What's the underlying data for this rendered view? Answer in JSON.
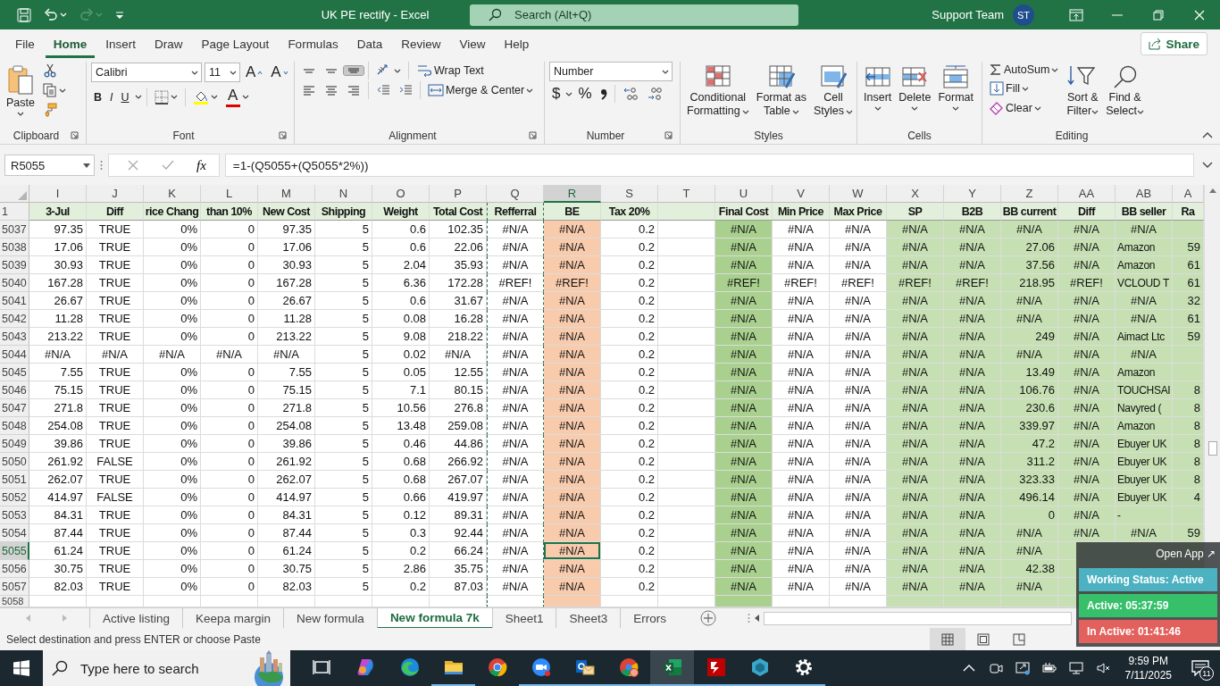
{
  "title_bar": {
    "title": "UK PE rectify  -  Excel",
    "search_placeholder": "Search (Alt+Q)",
    "user": "Support Team",
    "initials": "ST"
  },
  "menu_tabs": [
    {
      "label": "File",
      "selected": false
    },
    {
      "label": "Home",
      "selected": true
    },
    {
      "label": "Insert",
      "selected": false
    },
    {
      "label": "Draw",
      "selected": false
    },
    {
      "label": "Page Layout",
      "selected": false
    },
    {
      "label": "Formulas",
      "selected": false
    },
    {
      "label": "Data",
      "selected": false
    },
    {
      "label": "Review",
      "selected": false
    },
    {
      "label": "View",
      "selected": false
    },
    {
      "label": "Help",
      "selected": false
    }
  ],
  "share": "Share",
  "ribbon": {
    "clipboard": {
      "paste": "Paste",
      "label": "Clipboard"
    },
    "font": {
      "font": "Calibri",
      "size": "11",
      "grow": "A",
      "shrink": "A",
      "bold": "B",
      "italic": "I",
      "underline": "U",
      "font_color": "A",
      "label": "Font"
    },
    "alignment": {
      "wrap": "Wrap Text",
      "merge": "Merge & Center",
      "label": "Alignment"
    },
    "number": {
      "format": "Number",
      "currency": "$",
      "percent": "%",
      "label": "Number"
    },
    "styles": {
      "buttons": [
        [
          "Conditional",
          "Formatting"
        ],
        [
          "Format as",
          "Table"
        ],
        [
          "Cell",
          "Styles"
        ]
      ],
      "label": "Styles"
    },
    "cells": {
      "buttons": [
        "Insert",
        "Delete",
        "Format"
      ],
      "label": "Cells"
    },
    "editing": {
      "autosum": "AutoSum",
      "fill": "Fill",
      "clear": "Clear",
      "sort": [
        "Sort &",
        "Filter"
      ],
      "find": [
        "Find &",
        "Select"
      ],
      "label": "Editing"
    }
  },
  "formula_bar": {
    "name_box": "R5055",
    "function_label": "fx",
    "formula": "=1-(Q5055+(Q5055*2%))"
  },
  "columns": [
    {
      "letter": "I",
      "heading": "3-Jul",
      "kind": "number",
      "selected": false
    },
    {
      "letter": "J",
      "heading": "Diff",
      "kind": "bool",
      "selected": false
    },
    {
      "letter": "K",
      "heading": "rice Chang",
      "kind": "number",
      "selected": false
    },
    {
      "letter": "L",
      "heading": "than 10%",
      "kind": "number",
      "selected": false
    },
    {
      "letter": "M",
      "heading": "New Cost",
      "kind": "number",
      "selected": false
    },
    {
      "letter": "N",
      "heading": "Shipping",
      "kind": "number",
      "selected": false
    },
    {
      "letter": "O",
      "heading": "Weight",
      "kind": "number",
      "selected": false
    },
    {
      "letter": "P",
      "heading": "Total Cost",
      "kind": "number",
      "selected": false
    },
    {
      "letter": "Q",
      "heading": "Refferral",
      "kind": "number",
      "selected": false,
      "marquee": true
    },
    {
      "letter": "R",
      "heading": "BE",
      "kind": "number",
      "selected": true,
      "color": "#f8cbad"
    },
    {
      "letter": "S",
      "heading": "Tax 20%",
      "kind": "number",
      "selected": false
    },
    {
      "letter": "T",
      "selected": false
    },
    {
      "letter": "U",
      "heading": "Final Cost",
      "kind": "number",
      "selected": false,
      "color": "#a9d08e"
    },
    {
      "letter": "V",
      "heading": "Min Price",
      "kind": "number",
      "selected": false
    },
    {
      "letter": "W",
      "heading": "Max Price",
      "kind": "number",
      "selected": false
    },
    {
      "letter": "X",
      "heading": "SP",
      "kind": "number",
      "selected": false,
      "color": "#c6e0b4"
    },
    {
      "letter": "Y",
      "heading": "B2B",
      "kind": "number",
      "selected": false,
      "color": "#c6e0b4"
    },
    {
      "letter": "Z",
      "heading": "BB current",
      "kind": "number",
      "selected": false,
      "color": "#c6e0b4"
    },
    {
      "letter": "AA",
      "heading": "Diff",
      "kind": "number",
      "selected": false,
      "color": "#c6e0b4"
    },
    {
      "letter": "AB",
      "heading": "BB seller",
      "kind": "text",
      "selected": false,
      "color": "#c6e0b4"
    },
    {
      "letter": "A",
      "heading": "Ra",
      "kind": "number",
      "selected": false,
      "color": "#c6e0b4"
    }
  ],
  "header_row": "1",
  "rows": [
    {
      "number": "5037",
      "selected": false,
      "cells": [
        "97.35",
        "TRUE",
        "0%",
        "0",
        "97.35",
        "5",
        "0.6",
        "102.35",
        "#N/A",
        "#N/A",
        "0.2",
        null,
        "#N/A",
        "#N/A",
        "#N/A",
        "#N/A",
        "#N/A",
        "#N/A",
        "#N/A",
        "#N/A",
        null
      ]
    },
    {
      "number": "5038",
      "selected": false,
      "cells": [
        "17.06",
        "TRUE",
        "0%",
        "0",
        "17.06",
        "5",
        "0.6",
        "22.06",
        "#N/A",
        "#N/A",
        "0.2",
        null,
        "#N/A",
        "#N/A",
        "#N/A",
        "#N/A",
        "#N/A",
        "27.06",
        "#N/A",
        "Amazon",
        "59"
      ]
    },
    {
      "number": "5039",
      "selected": false,
      "cells": [
        "30.93",
        "TRUE",
        "0%",
        "0",
        "30.93",
        "5",
        "2.04",
        "35.93",
        "#N/A",
        "#N/A",
        "0.2",
        null,
        "#N/A",
        "#N/A",
        "#N/A",
        "#N/A",
        "#N/A",
        "37.56",
        "#N/A",
        "Amazon",
        "61"
      ]
    },
    {
      "number": "5040",
      "selected": false,
      "cells": [
        "167.28",
        "TRUE",
        "0%",
        "0",
        "167.28",
        "5",
        "6.36",
        "172.28",
        "#REF!",
        "#REF!",
        "0.2",
        null,
        "#REF!",
        "#REF!",
        "#REF!",
        "#REF!",
        "#REF!",
        "218.95",
        "#REF!",
        "VCLOUD T",
        "61"
      ]
    },
    {
      "number": "5041",
      "selected": false,
      "cells": [
        "26.67",
        "TRUE",
        "0%",
        "0",
        "26.67",
        "5",
        "0.6",
        "31.67",
        "#N/A",
        "#N/A",
        "0.2",
        null,
        "#N/A",
        "#N/A",
        "#N/A",
        "#N/A",
        "#N/A",
        "#N/A",
        "#N/A",
        "#N/A",
        "32"
      ]
    },
    {
      "number": "5042",
      "selected": false,
      "cells": [
        "11.28",
        "TRUE",
        "0%",
        "0",
        "11.28",
        "5",
        "0.08",
        "16.28",
        "#N/A",
        "#N/A",
        "0.2",
        null,
        "#N/A",
        "#N/A",
        "#N/A",
        "#N/A",
        "#N/A",
        "#N/A",
        "#N/A",
        "#N/A",
        "61"
      ]
    },
    {
      "number": "5043",
      "selected": false,
      "cells": [
        "213.22",
        "TRUE",
        "0%",
        "0",
        "213.22",
        "5",
        "9.08",
        "218.22",
        "#N/A",
        "#N/A",
        "0.2",
        null,
        "#N/A",
        "#N/A",
        "#N/A",
        "#N/A",
        "#N/A",
        "249",
        "#N/A",
        "Aimact Ltc",
        "59"
      ]
    },
    {
      "number": "5044",
      "selected": false,
      "cells": [
        "#N/A",
        "#N/A",
        "#N/A",
        "#N/A",
        "#N/A",
        "5",
        "0.02",
        "#N/A",
        "#N/A",
        "#N/A",
        "0.2",
        null,
        "#N/A",
        "#N/A",
        "#N/A",
        "#N/A",
        "#N/A",
        "#N/A",
        "#N/A",
        "#N/A",
        null
      ]
    },
    {
      "number": "5045",
      "selected": false,
      "cells": [
        "7.55",
        "TRUE",
        "0%",
        "0",
        "7.55",
        "5",
        "0.05",
        "12.55",
        "#N/A",
        "#N/A",
        "0.2",
        null,
        "#N/A",
        "#N/A",
        "#N/A",
        "#N/A",
        "#N/A",
        "13.49",
        "#N/A",
        "Amazon",
        null
      ]
    },
    {
      "number": "5046",
      "selected": false,
      "cells": [
        "75.15",
        "TRUE",
        "0%",
        "0",
        "75.15",
        "5",
        "7.1",
        "80.15",
        "#N/A",
        "#N/A",
        "0.2",
        null,
        "#N/A",
        "#N/A",
        "#N/A",
        "#N/A",
        "#N/A",
        "106.76",
        "#N/A",
        "TOUCHSAI",
        "8"
      ]
    },
    {
      "number": "5047",
      "selected": false,
      "cells": [
        "271.8",
        "TRUE",
        "0%",
        "0",
        "271.8",
        "5",
        "10.56",
        "276.8",
        "#N/A",
        "#N/A",
        "0.2",
        null,
        "#N/A",
        "#N/A",
        "#N/A",
        "#N/A",
        "#N/A",
        "230.6",
        "#N/A",
        "Navyred (",
        "8"
      ]
    },
    {
      "number": "5048",
      "selected": false,
      "cells": [
        "254.08",
        "TRUE",
        "0%",
        "0",
        "254.08",
        "5",
        "13.48",
        "259.08",
        "#N/A",
        "#N/A",
        "0.2",
        null,
        "#N/A",
        "#N/A",
        "#N/A",
        "#N/A",
        "#N/A",
        "339.97",
        "#N/A",
        "Amazon",
        "8"
      ]
    },
    {
      "number": "5049",
      "selected": false,
      "cells": [
        "39.86",
        "TRUE",
        "0%",
        "0",
        "39.86",
        "5",
        "0.46",
        "44.86",
        "#N/A",
        "#N/A",
        "0.2",
        null,
        "#N/A",
        "#N/A",
        "#N/A",
        "#N/A",
        "#N/A",
        "47.2",
        "#N/A",
        "Ebuyer UK",
        "8"
      ]
    },
    {
      "number": "5050",
      "selected": false,
      "cells": [
        "261.92",
        "FALSE",
        "0%",
        "0",
        "261.92",
        "5",
        "0.68",
        "266.92",
        "#N/A",
        "#N/A",
        "0.2",
        null,
        "#N/A",
        "#N/A",
        "#N/A",
        "#N/A",
        "#N/A",
        "311.2",
        "#N/A",
        "Ebuyer UK",
        "8"
      ]
    },
    {
      "number": "5051",
      "selected": false,
      "cells": [
        "262.07",
        "TRUE",
        "0%",
        "0",
        "262.07",
        "5",
        "0.68",
        "267.07",
        "#N/A",
        "#N/A",
        "0.2",
        null,
        "#N/A",
        "#N/A",
        "#N/A",
        "#N/A",
        "#N/A",
        "323.33",
        "#N/A",
        "Ebuyer UK",
        "8"
      ]
    },
    {
      "number": "5052",
      "selected": false,
      "cells": [
        "414.97",
        "FALSE",
        "0%",
        "0",
        "414.97",
        "5",
        "0.66",
        "419.97",
        "#N/A",
        "#N/A",
        "0.2",
        null,
        "#N/A",
        "#N/A",
        "#N/A",
        "#N/A",
        "#N/A",
        "496.14",
        "#N/A",
        "Ebuyer UK",
        "4"
      ]
    },
    {
      "number": "5053",
      "selected": false,
      "cells": [
        "84.31",
        "TRUE",
        "0%",
        "0",
        "84.31",
        "5",
        "0.12",
        "89.31",
        "#N/A",
        "#N/A",
        "0.2",
        null,
        "#N/A",
        "#N/A",
        "#N/A",
        "#N/A",
        "#N/A",
        "0",
        "#N/A",
        "-",
        null
      ]
    },
    {
      "number": "5054",
      "selected": false,
      "cells": [
        "87.44",
        "TRUE",
        "0%",
        "0",
        "87.44",
        "5",
        "0.3",
        "92.44",
        "#N/A",
        "#N/A",
        "0.2",
        null,
        "#N/A",
        "#N/A",
        "#N/A",
        "#N/A",
        "#N/A",
        "#N/A",
        "#N/A",
        "#N/A",
        "59"
      ]
    },
    {
      "number": "5055",
      "selected": true,
      "cells": [
        "61.24",
        "TRUE",
        "0%",
        "0",
        "61.24",
        "5",
        "0.2",
        "66.24",
        "#N/A",
        "#N/A",
        "0.2",
        null,
        "#N/A",
        "#N/A",
        "#N/A",
        "#N/A",
        "#N/A",
        "#N/A",
        null,
        null,
        null
      ]
    },
    {
      "number": "5056",
      "selected": false,
      "cells": [
        "30.75",
        "TRUE",
        "0%",
        "0",
        "30.75",
        "5",
        "2.86",
        "35.75",
        "#N/A",
        "#N/A",
        "0.2",
        null,
        "#N/A",
        "#N/A",
        "#N/A",
        "#N/A",
        "#N/A",
        "42.38",
        null,
        null,
        null
      ]
    },
    {
      "number": "5057",
      "selected": false,
      "cells": [
        "82.03",
        "TRUE",
        "0%",
        "0",
        "82.03",
        "5",
        "0.2",
        "87.03",
        "#N/A",
        "#N/A",
        "0.2",
        null,
        "#N/A",
        "#N/A",
        "#N/A",
        "#N/A",
        "#N/A",
        "#N/A",
        null,
        null,
        null
      ]
    },
    {
      "number": "5058",
      "selected": false
    }
  ],
  "sheet_tabs": [
    {
      "label": "Active listing",
      "selected": false
    },
    {
      "label": "Keepa margin",
      "selected": false
    },
    {
      "label": "New formula",
      "selected": false
    },
    {
      "label": "New formula 7k",
      "selected": true
    },
    {
      "label": "Sheet1",
      "selected": false
    },
    {
      "label": "Sheet3",
      "selected": false
    },
    {
      "label": "Errors",
      "selected": false
    }
  ],
  "status_bar": {
    "message": "Select destination and press ENTER or choose Paste"
  },
  "tracker": {
    "open_app": "Open App ↗",
    "status": "Working Status: Active",
    "active": "Active: 05:37:59",
    "inactive": "In Active: 01:41:46"
  },
  "taskbar": {
    "search_placeholder": "Type here to search",
    "apps": [
      {
        "running": false,
        "selected": false
      },
      {
        "running": false,
        "selected": false
      },
      {
        "running": false,
        "selected": false
      },
      {
        "running": true,
        "selected": false
      },
      {
        "running": false,
        "selected": false
      },
      {
        "running": true,
        "selected": false
      },
      {
        "running": true,
        "selected": false
      },
      {
        "running": true,
        "selected": false
      },
      {
        "running": true,
        "selected": true
      },
      {
        "running": true,
        "selected": false
      },
      {
        "running": true,
        "selected": false
      },
      {
        "running": true,
        "selected": false
      }
    ],
    "time": "9:59 PM",
    "date": "7/11/2025",
    "notifications": "11"
  }
}
